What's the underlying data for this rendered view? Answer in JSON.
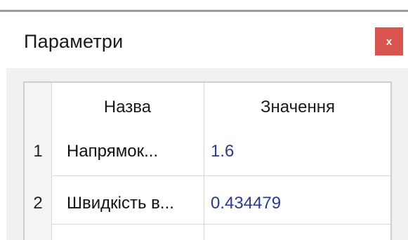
{
  "window": {
    "title": "Параметри",
    "close_label": "x"
  },
  "table": {
    "columns": [
      "Назва",
      "Значення"
    ],
    "rows": [
      {
        "index": "1",
        "name": "Напрямок...",
        "value": "1.6"
      },
      {
        "index": "2",
        "name": "Швидкість в...",
        "value": "0.434479"
      }
    ]
  },
  "colors": {
    "close_button": "#d9534f",
    "value_text": "#2b3a8c"
  }
}
